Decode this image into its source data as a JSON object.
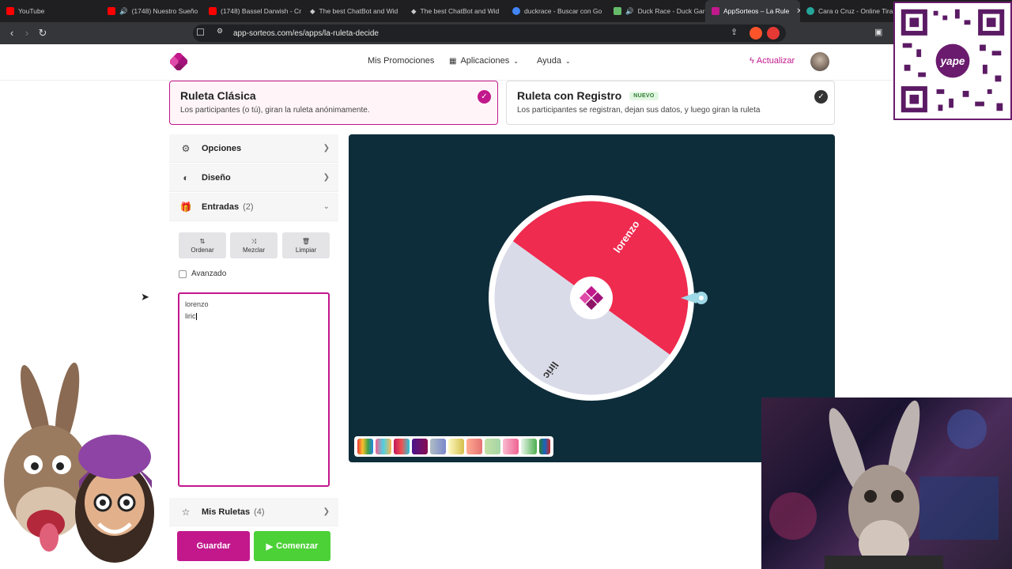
{
  "browser": {
    "tabs": [
      {
        "title": "YouTube",
        "favicon_color": "#ff0000",
        "active": false
      },
      {
        "title": "(1748) Nuestro Sueño",
        "favicon_color": "#ff0000",
        "active": false,
        "audio": true
      },
      {
        "title": "(1748) Bassel Darwish - Cr",
        "favicon_color": "#ff0000",
        "active": false
      },
      {
        "title": "The best ChatBot and Wid",
        "favicon_color": "#ffffff",
        "active": false
      },
      {
        "title": "The best ChatBot and Wid",
        "favicon_color": "#ffffff",
        "active": false
      },
      {
        "title": "duckrace - Buscar con Go",
        "favicon_color": "#4285f4",
        "active": false
      },
      {
        "title": "Duck Race - Duck Gar",
        "favicon_color": "#66bb6a",
        "active": false,
        "audio": true
      },
      {
        "title": "AppSorteos – La Rule",
        "favicon_color": "#c2188c",
        "active": true
      },
      {
        "title": "Cara o Cruz - Online Tira",
        "favicon_color": "#26a69a",
        "active": false
      }
    ],
    "url": "app-sorteos.com/es/apps/la-ruleta-decide"
  },
  "header": {
    "nav": [
      {
        "label": "Mis Promociones"
      },
      {
        "label": "Aplicaciones"
      },
      {
        "label": "Ayuda"
      }
    ],
    "upgrade_label": "Actualizar"
  },
  "modes": {
    "classic": {
      "title": "Ruleta Clásica",
      "description": "Los participantes (o tú), giran la ruleta anónimamente."
    },
    "registration": {
      "title": "Ruleta con Registro",
      "badge": "NUEVO",
      "description": "Los participantes se registran, dejan sus datos, y luego giran la ruleta"
    }
  },
  "sidebar": {
    "options_label": "Opciones",
    "design_label": "Diseño",
    "entries_label": "Entradas",
    "entries_count": "(2)",
    "actions": [
      {
        "label": "Ordenar",
        "icon": "sort-icon"
      },
      {
        "label": "Mezclar",
        "icon": "shuffle-icon"
      },
      {
        "label": "Limpiar",
        "icon": "trash-icon"
      }
    ],
    "advanced_label": "Avanzado",
    "entries": [
      "lorenzo",
      "liric"
    ],
    "my_wheels_label": "Mis Ruletas",
    "my_wheels_count": "(4)"
  },
  "buttons": {
    "save": "Guardar",
    "start": "Comenzar"
  },
  "wheel": {
    "segments": [
      {
        "label": "lorenzo",
        "color": "#ef2b4f"
      },
      {
        "label": "liric",
        "color": "#d9dbe9"
      }
    ],
    "background": "#0e2d3a",
    "accent": "#c2188c"
  },
  "overlay": {
    "qr_label": "yape"
  }
}
